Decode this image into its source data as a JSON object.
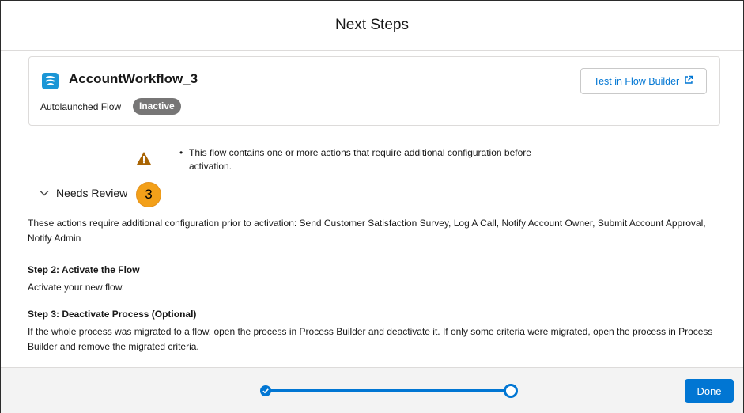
{
  "modal": {
    "title": "Next Steps"
  },
  "flow": {
    "name": "AccountWorkflow_3",
    "type": "Autolaunched Flow",
    "status": "Inactive",
    "test_button_label": "Test in Flow Builder"
  },
  "warning": {
    "bullet": "•",
    "message": "This flow contains one or more actions that require additional configuration before activation."
  },
  "needs_review": {
    "label": "Needs Review",
    "count": "3",
    "description": "These actions require additional configuration prior to activation: Send Customer Satisfaction Survey, Log A Call, Notify Account Owner, Submit Account Approval, Notify Admin"
  },
  "steps": [
    {
      "title": "Step 2: Activate the Flow",
      "description": "Activate your new flow."
    },
    {
      "title": "Step 3: Deactivate Process (Optional)",
      "description": "If the whole process was migrated to a flow, open the process in Process Builder and deactivate it. If only some criteria were migrated, open the process in Process Builder and remove the migrated criteria."
    }
  ],
  "footer": {
    "done_label": "Done",
    "progress": {
      "current_step": 2,
      "total_steps": 2
    }
  },
  "colors": {
    "brand": "#0176d3",
    "badge_inactive": "#777676",
    "warning": "#a96404",
    "count_badge": "#f3a019"
  },
  "icons": {
    "flow": "flow-icon",
    "external_link": "new-window-icon",
    "warning": "warning-triangle-icon",
    "chevron": "chevron-down-icon",
    "progress_complete": "check-icon"
  }
}
